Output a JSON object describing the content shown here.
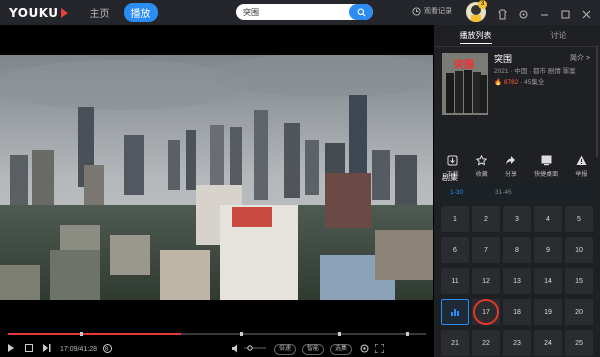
{
  "topbar": {
    "logo_text": "YOUKU",
    "nav_home": "主页",
    "nav_play": "播放",
    "search_value": "突围",
    "history_label": "观看记录",
    "avatar_badge": "3"
  },
  "panel": {
    "tabs": [
      {
        "label": "播放列表"
      },
      {
        "label": "讨论"
      }
    ],
    "show": {
      "title": "突围",
      "poster_text": "突围",
      "meta": "2021 · 中国 · 都市 剧情 罪案",
      "hot_value": "8782",
      "rating_suffix": " · 45集全",
      "intro_label": "简介 >"
    },
    "actions": [
      {
        "label": "下载",
        "icon": "download-icon"
      },
      {
        "label": "收藏",
        "icon": "star-icon"
      },
      {
        "label": "分享",
        "icon": "share-icon"
      },
      {
        "label": "快捷桌面",
        "icon": "desktop-shortcut-icon"
      },
      {
        "label": "举报",
        "icon": "warning-icon"
      }
    ],
    "episodes_label": "剧集",
    "ranges": [
      "1-30",
      "31-45"
    ],
    "episodes": [
      {
        "num": "1"
      },
      {
        "num": "2"
      },
      {
        "num": "3"
      },
      {
        "num": "4"
      },
      {
        "num": "5"
      },
      {
        "num": "6"
      },
      {
        "num": "7"
      },
      {
        "num": "8"
      },
      {
        "num": "9"
      },
      {
        "num": "10"
      },
      {
        "num": "11"
      },
      {
        "num": "12"
      },
      {
        "num": "13"
      },
      {
        "num": "14"
      },
      {
        "num": "15"
      },
      {
        "num": "",
        "state": "playing"
      },
      {
        "num": "17"
      },
      {
        "num": "18"
      },
      {
        "num": "19"
      },
      {
        "num": "20"
      },
      {
        "num": "21"
      },
      {
        "num": "22"
      },
      {
        "num": "23"
      },
      {
        "num": "24"
      },
      {
        "num": "25"
      }
    ]
  },
  "player": {
    "time": "17:09/41:28",
    "progress_fraction": 0.414,
    "buttons": [
      "倍速",
      "智能",
      "选集"
    ],
    "colors": {
      "accent": "#2b8df2",
      "progress": "#e53935"
    }
  }
}
